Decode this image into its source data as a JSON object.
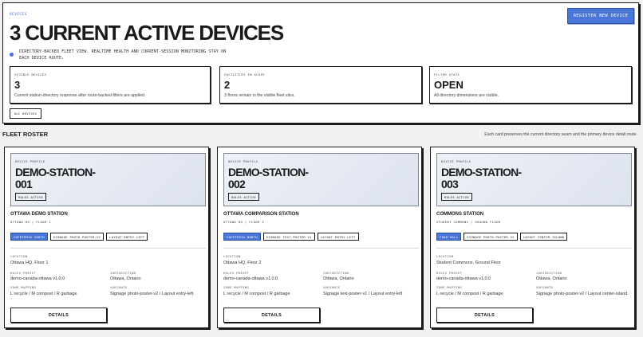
{
  "header": {
    "eyebrow": "DEVICES",
    "title": "3 CURRENT ACTIVE DEVICES",
    "description": "DIRECTORY-BACKED FLEET VIEW. REALTIME HEALTH AND CURRENT-SESSION MONITORING STAY ON EACH DEVICE ROUTE.",
    "register_label": "REGISTER NEW DEVICE"
  },
  "stats": [
    {
      "label": "VISIBLE DEVICES",
      "value": "3",
      "note": "Current station-directory response after route-backed filters are applied."
    },
    {
      "label": "FACILITIES IN SCOPE",
      "value": "2",
      "note": "3 floors remain in the visible fleet slice."
    },
    {
      "label": "FILTER STATE",
      "value": "OPEN",
      "note": "All directory dimensions are visible."
    }
  ],
  "filter_button": "ALL DEVICES",
  "roster": {
    "title": "FLEET ROSTER",
    "note": "Each card preserves the current directory seam and the primary device detail route."
  },
  "field_labels": {
    "profile": "DEVICE PROFILE",
    "location": "LOCATION",
    "rules_preset": "RULES PRESET",
    "jurisdiction": "JURISDICTION",
    "zone_mapping": "ZONE MAPPING",
    "variants": "VARIANTS"
  },
  "details_label": "DETAILS",
  "devices": [
    {
      "name": "DEMO-STATION-001",
      "rules_badge": "RULES ACTIVE",
      "station": "OTTAWA DEMO STATION",
      "substation": "OTTAWA HQ / FLOOR 1",
      "tags": [
        "CAFETERIA SOUTH",
        "SIGNAGE PHOTO-POSTER-V2",
        "LAYOUT ENTRY-LEFT"
      ],
      "location": "Ottawa HQ, Floor 1",
      "rules_preset": "demo-canada-ottawa v1.0.0",
      "jurisdiction": "Ottawa, Ontario",
      "zone_mapping": "L recycle / M compost / R garbage",
      "variants": "Signage photo-poster-v2 / Layout entry-left"
    },
    {
      "name": "DEMO-STATION-002",
      "rules_badge": "RULES ACTIVE",
      "station": "OTTAWA COMPARISON STATION",
      "substation": "OTTAWA HQ / FLOOR 2",
      "tags": [
        "CAFETERIA NORTH",
        "SIGNAGE TEXT-POSTER-V1",
        "LAYOUT ENTRY-LEFT"
      ],
      "location": "Ottawa HQ, Floor 2",
      "rules_preset": "demo-canada-ottawa v1.0.0",
      "jurisdiction": "Ottawa, Ontario",
      "zone_mapping": "L recycle / M compost / R garbage",
      "variants": "Signage text-poster-v1 / Layout entry-left"
    },
    {
      "name": "DEMO-STATION-003",
      "rules_badge": "RULES ACTIVE",
      "station": "COMMONS STATION",
      "substation": "STUDENT COMMONS / GROUND FLOOR",
      "tags": [
        "FOOD HALL",
        "SIGNAGE PHOTO-POSTER-V2",
        "LAYOUT CENTER-ISLAND"
      ],
      "location": "Student Commons, Ground Floor",
      "rules_preset": "demo-canada-ottawa v1.0.0",
      "jurisdiction": "Ottawa, Ontario",
      "zone_mapping": "L recycle / M compost / R garbage",
      "variants": "Signage photo-poster-v2 / Layout center-island"
    }
  ],
  "colors": {
    "accent": "#4a76d8",
    "border": "#1a1a1a"
  }
}
